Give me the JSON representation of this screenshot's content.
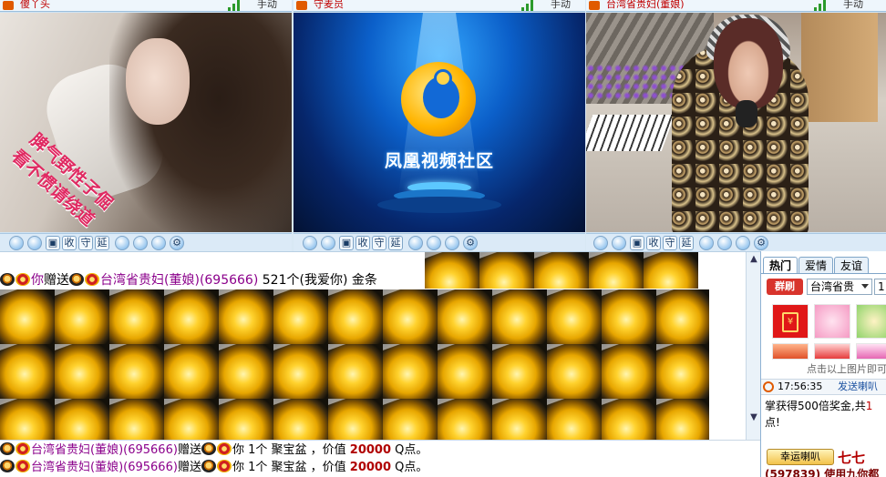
{
  "panels": [
    {
      "name": "傻丫头",
      "mode": "手动"
    },
    {
      "name": "守麦员",
      "mode": "手动",
      "brand": "凤凰视频社区"
    },
    {
      "name": "台湾省贵妇(董娘)",
      "mode": "手动"
    }
  ],
  "video1_caption": {
    "line1": "脾气野性子倔",
    "line2": "看不惯请绕道"
  },
  "toolbar": {
    "btn_receive": "收",
    "btn_guard": "守",
    "btn_delay": "延"
  },
  "gift_line": {
    "giver": "你",
    "action": "赠送",
    "recipient": "台湾省贵妇(董娘)",
    "recipient_id": "(695666)",
    "detail": "521个(我爱你) 金条"
  },
  "system_lines": [
    {
      "name": "台湾省贵妇(董娘)",
      "id": "(695666)",
      "action": "赠送",
      "target": "你",
      "detail": "1个 聚宝盆 ，价值",
      "value": "20000",
      "unit": "Q点。"
    },
    {
      "name": "台湾省贵妇(董娘)",
      "id": "(695666)",
      "action": "赠送",
      "target": "你",
      "detail": "1个 聚宝盆 ，价值",
      "value": "20000",
      "unit": "Q点。"
    }
  ],
  "side": {
    "tabs": [
      "热门",
      "爱情",
      "友谊"
    ],
    "refresh_label": "群刷",
    "region": "台湾省贵",
    "region2": "1",
    "hint": "点击以上图片即可",
    "time": "17:56:35",
    "send_label": "发送喇叭",
    "notice_line1a": "掌获得500倍奖金,共",
    "notice_line1b": "1",
    "notice_line2": "点!",
    "lucky_label": "幸运喇叭",
    "lucky_name": "七七",
    "bottom_text": "(597839) 使用九你都"
  },
  "colors": {
    "accent": "#c00000",
    "name_purple": "#8b008b",
    "panel_bg": "#cfe3f3"
  }
}
